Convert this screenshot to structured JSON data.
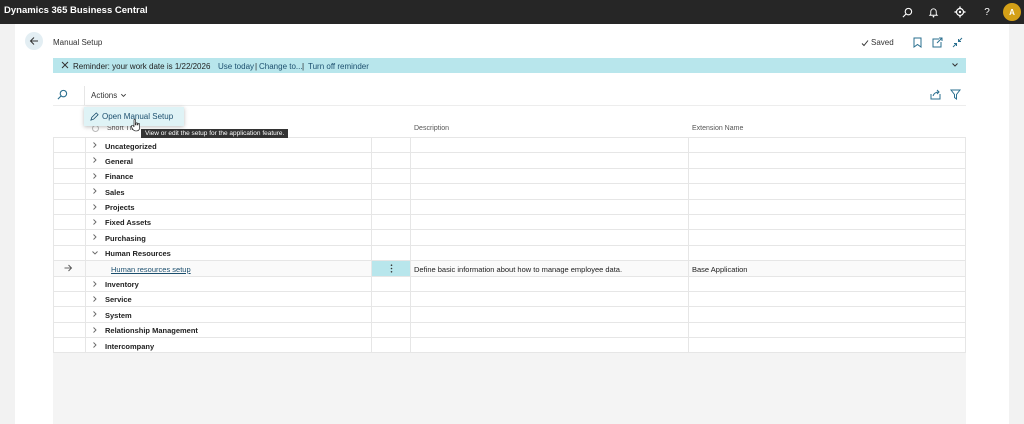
{
  "app": {
    "title": "Dynamics 365 Business Central",
    "avatar_initial": "A"
  },
  "topbar_icons": [
    "search-icon",
    "bell-icon",
    "gear-icon",
    "help-icon"
  ],
  "header": {
    "title": "Manual Setup",
    "saved_label": "Saved"
  },
  "reminder": {
    "text": "Reminder: your work date is 1/22/2026",
    "use_today": "Use today",
    "change_to": "Change to...",
    "turn_off": "Turn off reminder",
    "sep1": "|",
    "sep2": "|"
  },
  "actionbar": {
    "actions_label": "Actions"
  },
  "dropdown": {
    "item_label": "Open Manual Setup",
    "tooltip": "View or edit the setup for the application feature."
  },
  "columns": {
    "short_title": "Short Title",
    "description": "Description",
    "extension_name": "Extension Name"
  },
  "rows": [
    {
      "label": "Uncategorized"
    },
    {
      "label": "General"
    },
    {
      "label": "Finance"
    },
    {
      "label": "Sales"
    },
    {
      "label": "Projects"
    },
    {
      "label": "Fixed Assets"
    },
    {
      "label": "Purchasing"
    },
    {
      "label": "Human Resources"
    },
    {
      "label": "Human resources setup",
      "description": "Define basic information about how to manage employee data.",
      "extension": "Base Application"
    },
    {
      "label": "Inventory"
    },
    {
      "label": "Service"
    },
    {
      "label": "System"
    },
    {
      "label": "Relationship Management"
    },
    {
      "label": "Intercompany"
    }
  ],
  "colors": {
    "topbar": "#262626",
    "accent": "#b8e6ec",
    "link": "#1c4f6e",
    "avatar": "#d4a017"
  }
}
